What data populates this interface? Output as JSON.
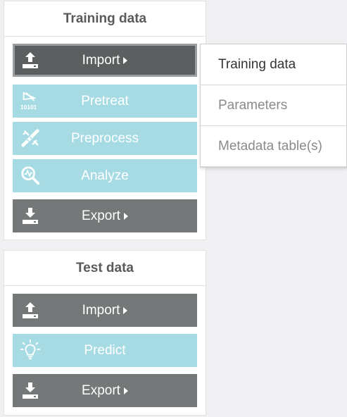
{
  "training_panel": {
    "title": "Training data",
    "buttons": [
      {
        "label": "Import",
        "icon": "upload-icon"
      },
      {
        "label": "Pretreat",
        "icon": "binary-icon"
      },
      {
        "label": "Preprocess",
        "icon": "tools-icon"
      },
      {
        "label": "Analyze",
        "icon": "analyze-icon"
      },
      {
        "label": "Export",
        "icon": "download-icon"
      }
    ]
  },
  "test_panel": {
    "title": "Test data",
    "buttons": [
      {
        "label": "Import",
        "icon": "upload-icon"
      },
      {
        "label": "Predict",
        "icon": "lightbulb-icon"
      },
      {
        "label": "Export",
        "icon": "download-icon"
      }
    ]
  },
  "import_menu": {
    "items": [
      "Training data",
      "Parameters",
      "Metadata table(s)"
    ]
  },
  "colors": {
    "gray_button": "#747879",
    "gray_button_active": "#5b5f60",
    "teal_button": "#a6dbe3",
    "background": "#f0f0f3"
  }
}
